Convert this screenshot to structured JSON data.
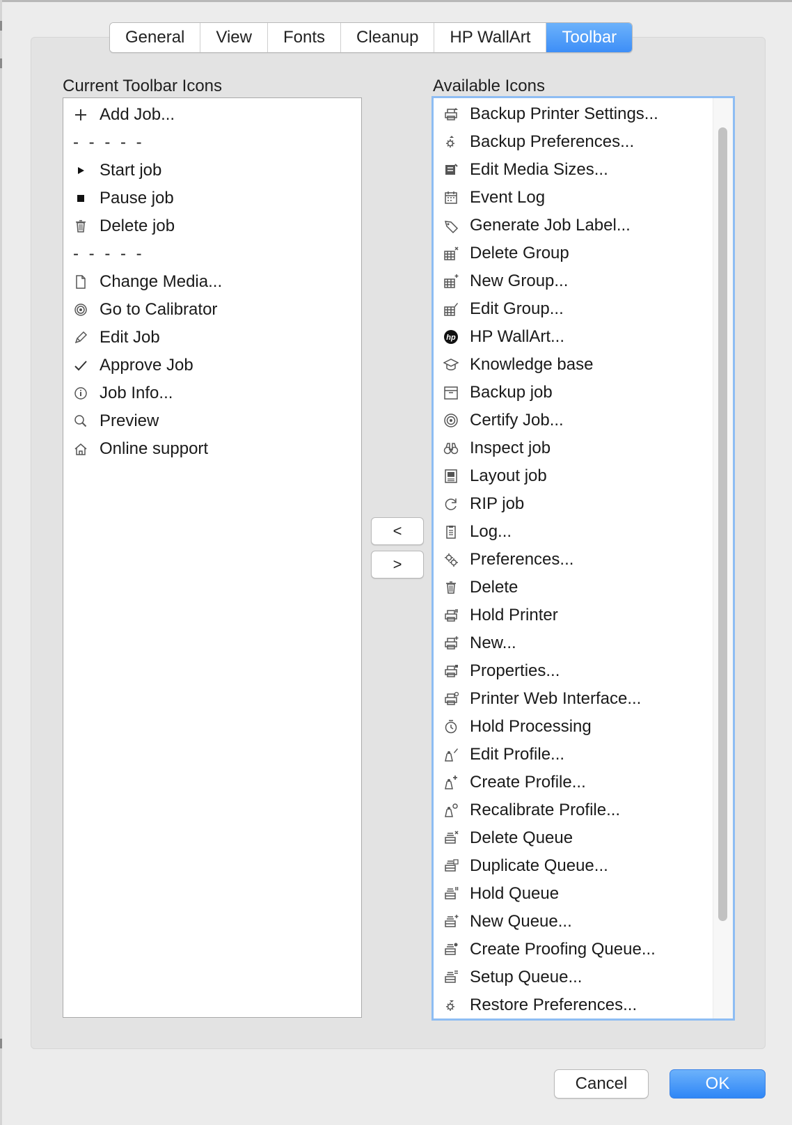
{
  "tabs": [
    "General",
    "View",
    "Fonts",
    "Cleanup",
    "HP WallArt",
    "Toolbar"
  ],
  "active_tab": "Toolbar",
  "current": {
    "label": "Current Toolbar Icons",
    "items": [
      {
        "label": "Add Job...",
        "icon": "plus-icon"
      },
      {
        "label": "- - - - -",
        "icon": "separator"
      },
      {
        "label": "Start job",
        "icon": "play-icon"
      },
      {
        "label": "Pause job",
        "icon": "stop-square-icon"
      },
      {
        "label": "Delete job",
        "icon": "trash-icon"
      },
      {
        "label": "- - - - -",
        "icon": "separator"
      },
      {
        "label": "Change Media...",
        "icon": "page-icon"
      },
      {
        "label": "Go to Calibrator",
        "icon": "target-icon"
      },
      {
        "label": "Edit Job",
        "icon": "pencil-icon"
      },
      {
        "label": "Approve Job",
        "icon": "check-icon"
      },
      {
        "label": "Job Info...",
        "icon": "info-icon"
      },
      {
        "label": "Preview",
        "icon": "magnifier-icon"
      },
      {
        "label": "Online support",
        "icon": "home-icon"
      }
    ]
  },
  "available": {
    "label": "Available Icons",
    "items": [
      {
        "label": "Backup Printer Settings...",
        "icon": "printer-up-icon"
      },
      {
        "label": "Backup Preferences...",
        "icon": "gear-up-icon"
      },
      {
        "label": "Edit Media Sizes...",
        "icon": "media-sizes-icon"
      },
      {
        "label": "Event Log",
        "icon": "calendar-icon"
      },
      {
        "label": "Generate Job Label...",
        "icon": "tag-icon"
      },
      {
        "label": "Delete Group",
        "icon": "group-delete-icon"
      },
      {
        "label": "New Group...",
        "icon": "group-new-icon"
      },
      {
        "label": "Edit Group...",
        "icon": "group-edit-icon"
      },
      {
        "label": "HP WallArt...",
        "icon": "hp-logo-icon"
      },
      {
        "label": "Knowledge base",
        "icon": "graduation-cap-icon"
      },
      {
        "label": "Backup job",
        "icon": "archive-box-icon"
      },
      {
        "label": "Certify Job...",
        "icon": "certify-target-icon"
      },
      {
        "label": "Inspect job",
        "icon": "binoculars-icon"
      },
      {
        "label": "Layout job",
        "icon": "layout-icon"
      },
      {
        "label": "RIP job",
        "icon": "refresh-icon"
      },
      {
        "label": "Log...",
        "icon": "clipboard-icon"
      },
      {
        "label": "Preferences...",
        "icon": "gears-icon"
      },
      {
        "label": "Delete",
        "icon": "trash-icon"
      },
      {
        "label": "Hold Printer",
        "icon": "printer-hold-icon"
      },
      {
        "label": "New...",
        "icon": "printer-new-icon"
      },
      {
        "label": "Properties...",
        "icon": "printer-properties-icon"
      },
      {
        "label": "Printer Web Interface...",
        "icon": "printer-web-icon"
      },
      {
        "label": "Hold Processing",
        "icon": "timer-icon"
      },
      {
        "label": "Edit Profile...",
        "icon": "profile-edit-icon"
      },
      {
        "label": "Create Profile...",
        "icon": "profile-create-icon"
      },
      {
        "label": "Recalibrate Profile...",
        "icon": "profile-recalibrate-icon"
      },
      {
        "label": "Delete Queue",
        "icon": "queue-delete-icon"
      },
      {
        "label": "Duplicate Queue...",
        "icon": "queue-duplicate-icon"
      },
      {
        "label": "Hold Queue",
        "icon": "queue-hold-icon"
      },
      {
        "label": "New Queue...",
        "icon": "queue-new-icon"
      },
      {
        "label": "Create Proofing Queue...",
        "icon": "queue-proofing-icon"
      },
      {
        "label": "Setup Queue...",
        "icon": "queue-setup-icon"
      },
      {
        "label": "Restore Preferences...",
        "icon": "gear-restore-icon"
      }
    ]
  },
  "move_left_label": "<",
  "move_right_label": ">",
  "cancel_label": "Cancel",
  "ok_label": "OK",
  "colors": {
    "accent": "#3d8ef7",
    "focus_ring": "#8ebdf3",
    "window_bg": "#ececec"
  }
}
